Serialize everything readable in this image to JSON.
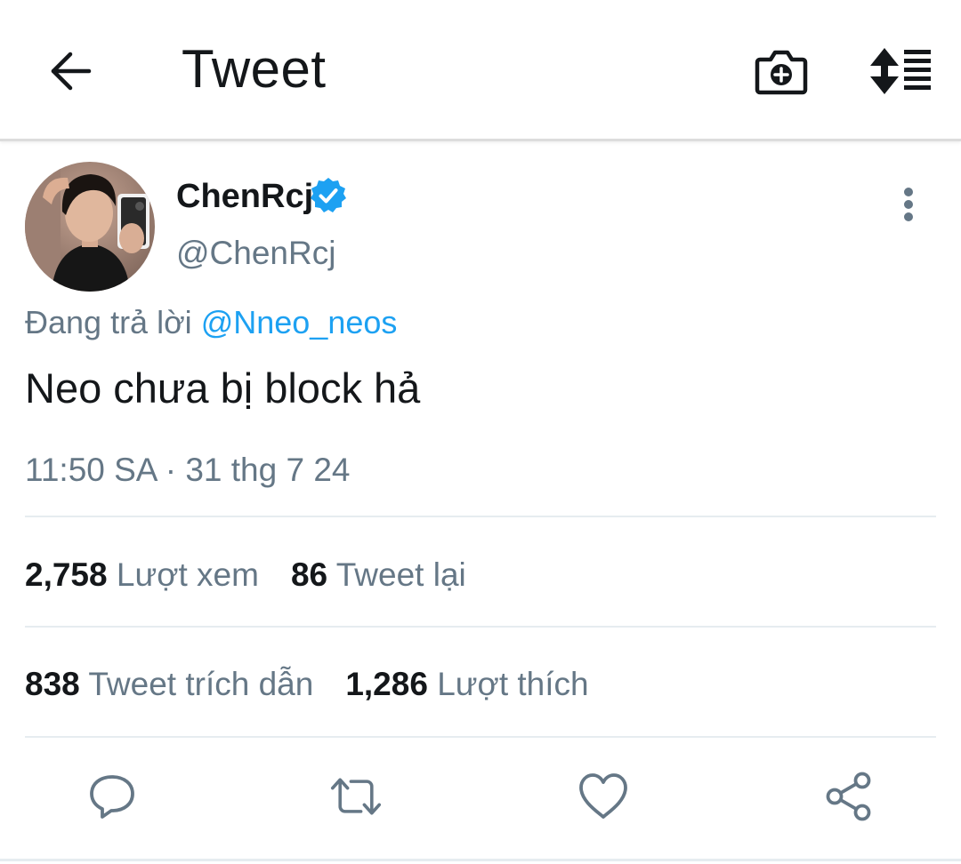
{
  "header": {
    "title": "Tweet",
    "icons": [
      "back-arrow-icon",
      "camera-plus-icon",
      "sort-order-icon"
    ]
  },
  "tweet": {
    "author": {
      "display_name": "ChenRcj",
      "handle": "@ChenRcj",
      "verified": true
    },
    "reply_prefix": "Đang trả lời",
    "reply_to": "@Nneo_neos",
    "text": "Neo chưa bị block hả",
    "timestamp": "11:50 SA · 31 thg 7 24"
  },
  "stats": {
    "views": {
      "count": "2,758",
      "label": "Lượt xem"
    },
    "retweets": {
      "count": "86",
      "label": "Tweet lại"
    },
    "quotes": {
      "count": "838",
      "label": "Tweet trích dẫn"
    },
    "likes": {
      "count": "1,286",
      "label": "Lượt thích"
    }
  },
  "actions": [
    "reply-icon",
    "retweet-icon",
    "like-icon",
    "share-icon"
  ],
  "colors": {
    "accent": "#1da1f2",
    "text": "#14171a",
    "secondary_text": "#657786",
    "divider": "#e6ecf0"
  }
}
